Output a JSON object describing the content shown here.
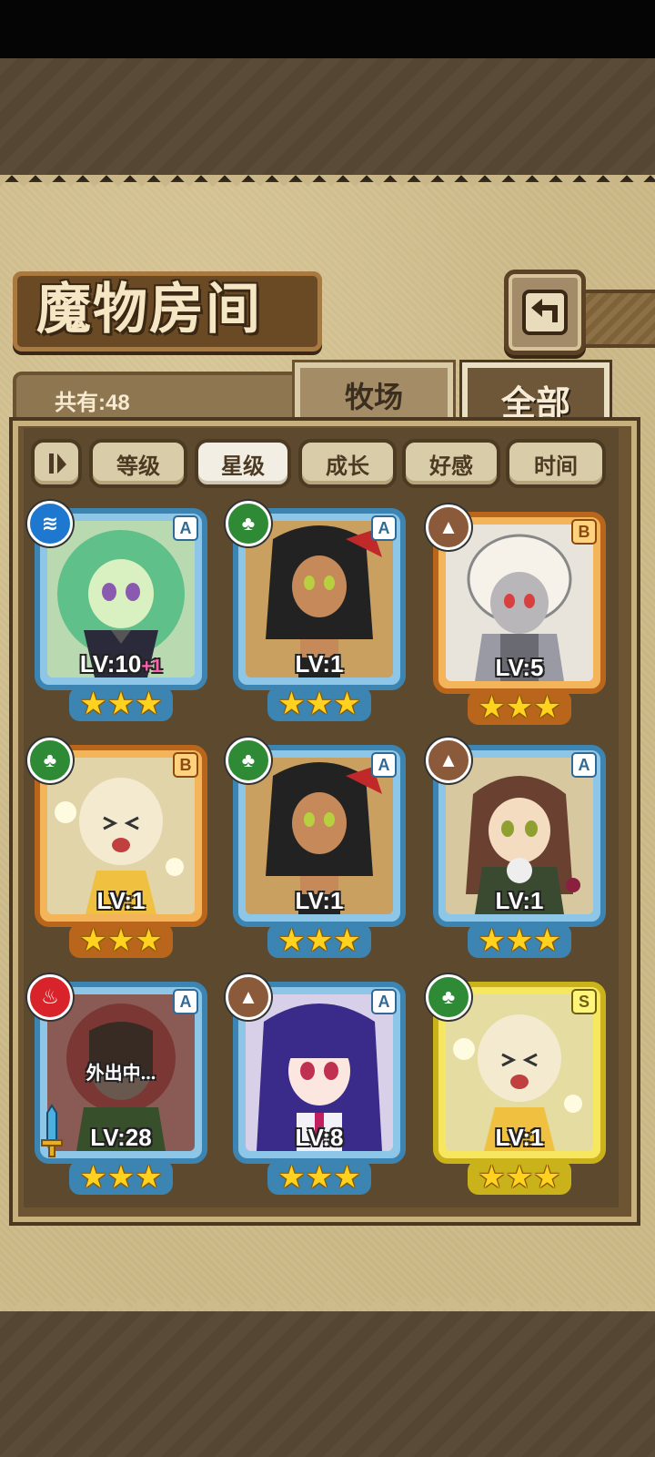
{
  "header": {
    "title": "魔物房间"
  },
  "summary": {
    "count_label": "共有:48"
  },
  "tabs": [
    {
      "label": "牧场",
      "active": false
    },
    {
      "label": "全部",
      "active": true
    }
  ],
  "sort_buttons": [
    {
      "label": "等级",
      "active": false
    },
    {
      "label": "星级",
      "active": true
    },
    {
      "label": "成长",
      "active": false
    },
    {
      "label": "好感",
      "active": false
    },
    {
      "label": "时间",
      "active": false
    }
  ],
  "monsters": [
    {
      "level": "LV:10",
      "level_bonus": "+1",
      "rank": "A",
      "element": "water",
      "stars": 3,
      "frame": "blue",
      "status": ""
    },
    {
      "level": "LV:1",
      "level_bonus": "",
      "rank": "A",
      "element": "wood",
      "stars": 3,
      "frame": "blue",
      "status": ""
    },
    {
      "level": "LV:5",
      "level_bonus": "",
      "rank": "B",
      "element": "earth",
      "stars": 3,
      "frame": "orange",
      "status": ""
    },
    {
      "level": "LV:1",
      "level_bonus": "",
      "rank": "B",
      "element": "wood",
      "stars": 3,
      "frame": "orange",
      "status": ""
    },
    {
      "level": "LV:1",
      "level_bonus": "",
      "rank": "A",
      "element": "wood",
      "stars": 3,
      "frame": "blue",
      "status": ""
    },
    {
      "level": "LV:1",
      "level_bonus": "",
      "rank": "A",
      "element": "earth",
      "stars": 3,
      "frame": "blue",
      "status": ""
    },
    {
      "level": "LV:28",
      "level_bonus": "",
      "rank": "A",
      "element": "fire",
      "stars": 3,
      "frame": "blue",
      "status": "外出中..."
    },
    {
      "level": "LV:8",
      "level_bonus": "",
      "rank": "A",
      "element": "earth",
      "stars": 3,
      "frame": "blue",
      "status": ""
    },
    {
      "level": "LV:1",
      "level_bonus": "",
      "rank": "S",
      "element": "wood",
      "stars": 3,
      "frame": "yellow",
      "status": ""
    }
  ],
  "colors": {
    "frame_blue": "#3c84b2",
    "frame_orange": "#b9661c",
    "frame_yellow": "#c9b21a",
    "star": "#ffd21f",
    "element_water": "#1e78d0",
    "element_wood": "#2f8a35",
    "element_earth": "#8a5a3a",
    "element_fire": "#d8232a"
  }
}
